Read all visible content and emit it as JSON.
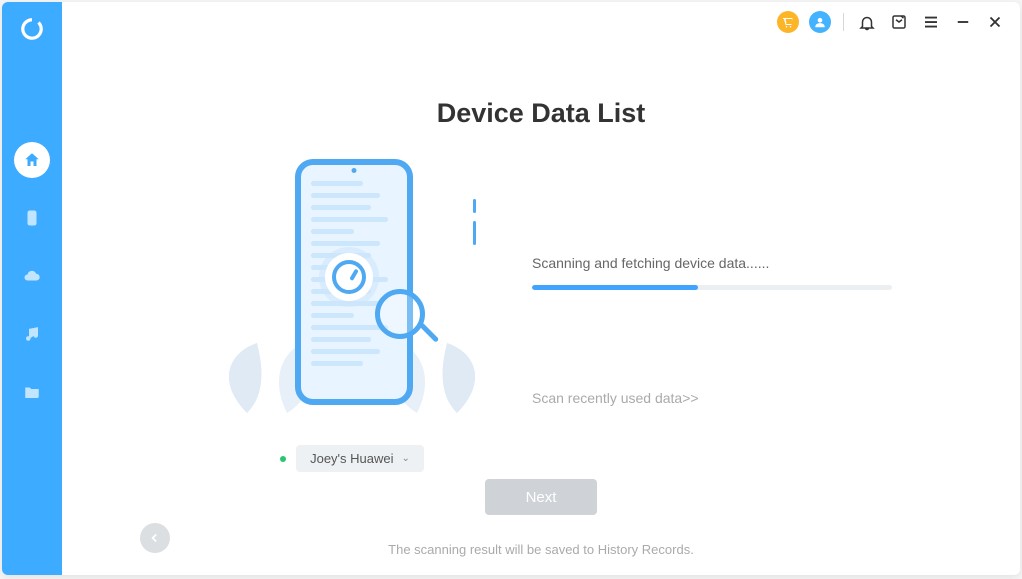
{
  "page": {
    "title": "Device Data List"
  },
  "device": {
    "name": "Joey's Huawei"
  },
  "scan": {
    "status_text": "Scanning and fetching device data......",
    "progress_percent": 46,
    "recent_link": "Scan recently used data>>"
  },
  "actions": {
    "next_label": "Next"
  },
  "footer": {
    "note": "The scanning result will be saved to History Records."
  },
  "colors": {
    "accent": "#3dabff"
  }
}
